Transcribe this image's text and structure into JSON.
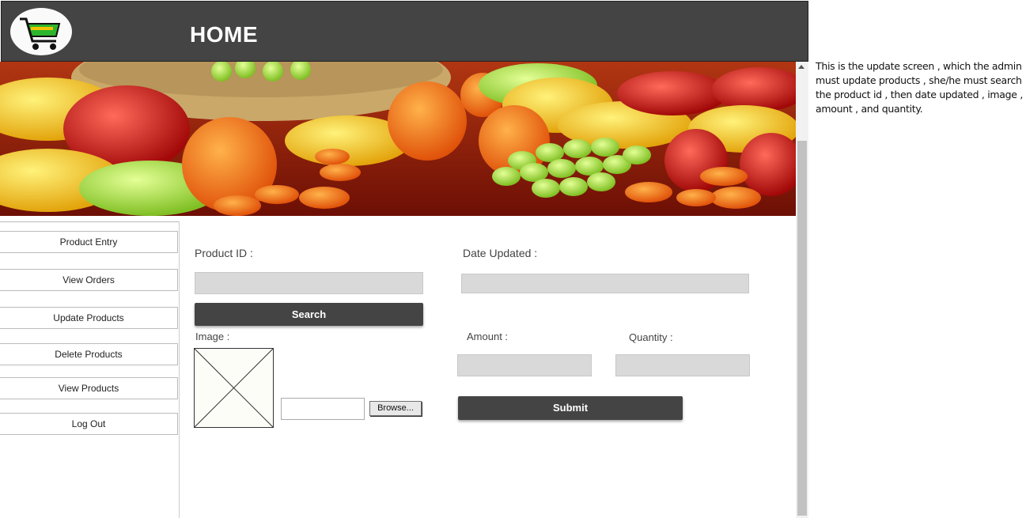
{
  "header": {
    "title": "HOME",
    "logo_icon": "shopping-cart-logo"
  },
  "sidebar": {
    "items": [
      {
        "label": "Product Entry"
      },
      {
        "label": "View Orders"
      },
      {
        "label": "Update Products"
      },
      {
        "label": "Delete Products"
      },
      {
        "label": "View Products"
      },
      {
        "label": "Log Out"
      }
    ]
  },
  "form": {
    "product_id_label": "Product ID :",
    "product_id_value": "",
    "date_updated_label": "Date Updated :",
    "date_updated_value": "",
    "search_label": "Search",
    "image_label": "Image :",
    "browse_label": "Browse...",
    "amount_label": "Amount :",
    "amount_value": "",
    "quantity_label": "Quantity :",
    "quantity_value": "",
    "submit_label": "Submit"
  },
  "note": "This is the update screen , which the admin must update products , she/he must search the product id , then date updated , image , amount , and quantity.",
  "colors": {
    "header": "#444444",
    "button": "#444444",
    "field": "#d9d9d9",
    "banner_accent": "#8a1a0a"
  }
}
